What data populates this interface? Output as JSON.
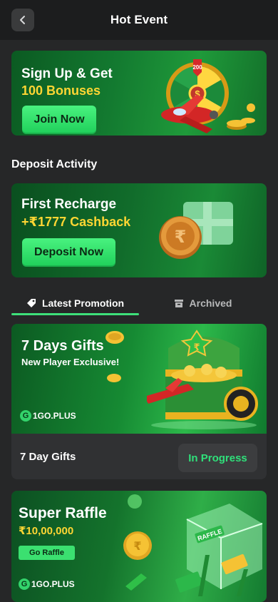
{
  "header": {
    "title": "Hot Event"
  },
  "banners": {
    "signup": {
      "line1": "Sign Up & Get",
      "line2": "100 Bonuses",
      "button": "Join Now",
      "wheel_label": "200"
    },
    "deposit": {
      "line1": "First Recharge",
      "line2": "+₹1777 Cashback",
      "button": "Deposit Now"
    }
  },
  "section": {
    "deposit_activity": "Deposit Activity"
  },
  "tabs": {
    "latest": "Latest Promotion",
    "archived": "Archived"
  },
  "promotions": [
    {
      "title": "7 Days Gifts",
      "subtitle": "New Player Exclusive!",
      "brand": "1GO.PLUS",
      "name": "7 Day Gifts",
      "status": "In Progress"
    },
    {
      "title": "Super Raffle",
      "amount": "₹10,00,000",
      "button": "Go Raffle",
      "brand": "1GO.PLUS",
      "box_label": "RAFFLE"
    }
  ]
}
